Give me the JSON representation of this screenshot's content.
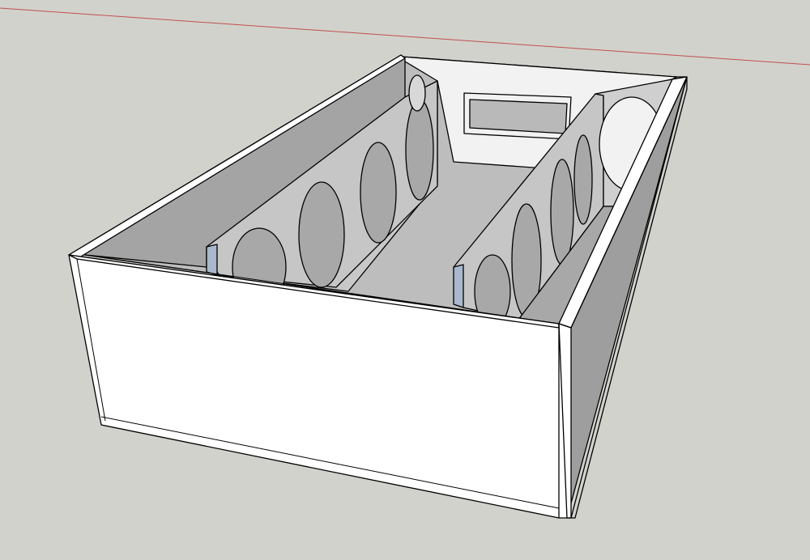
{
  "app": {
    "type": "3d-modeling-viewport"
  },
  "viewport": {
    "background_color": "#d2d2cc",
    "red_axis_color": "#c0504d",
    "edge_color": "#000000",
    "face_colors": {
      "front_white": "#ffffff",
      "inner_gray": "#a4a4a4",
      "inner_light": "#c8c8c8",
      "floor": "#bdbdbd",
      "back_panel": "#f2f2f2",
      "section_cut_blue": "#a9b8cc"
    }
  },
  "model": {
    "object": "speaker-enclosure-box",
    "icons": [
      "circle-cutout-icon",
      "rectangle-port-icon"
    ]
  }
}
